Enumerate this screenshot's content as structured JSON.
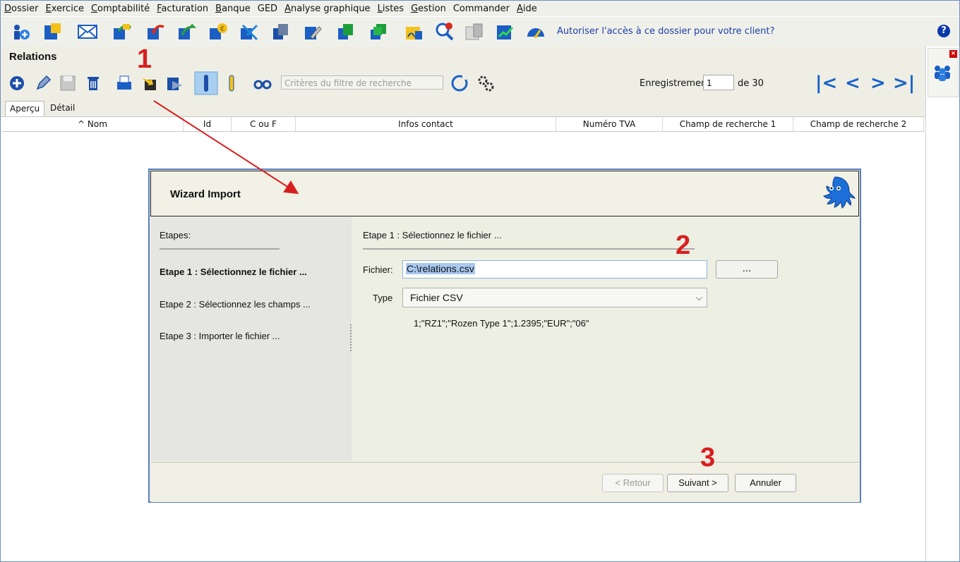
{
  "menu": [
    "Dossier",
    "Exercice",
    "Comptabilité",
    "Facturation",
    "Banque",
    "GED",
    "Analyse graphique",
    "Listes",
    "Gestion",
    "Commander",
    "Aide"
  ],
  "menu_underline": [
    0,
    0,
    0,
    0,
    0,
    null,
    0,
    0,
    0,
    null,
    0
  ],
  "main_toolbar": {
    "icons": [
      "add-dossier-icon",
      "notes-icon",
      "mail-icon",
      "exchange-icon",
      "import-icon",
      "export-icon",
      "currency-icon",
      "transfer-icon",
      "copy-icon",
      "edit-doc-icon",
      "green-doc-icon",
      "green-stack-icon",
      "sign-icon",
      "search-doc-icon",
      "doc-grid-icon",
      "chart-icon",
      "dashboard-icon"
    ],
    "link": "Autoriser l'accès à ce dossier pour votre client?",
    "help": "?"
  },
  "relations": {
    "title": "Relations",
    "search_placeholder": "Critères du filtre de recherche",
    "record_label": "Enregistrement",
    "record_value": "1",
    "record_of": "de 30",
    "nav": {
      "first": "|<",
      "prev": "<",
      "next": ">",
      "last": ">|"
    }
  },
  "tabs": [
    "Aperçu",
    "Détail"
  ],
  "columns": [
    "^ Nom",
    "Id",
    "C ou F",
    "Infos contact",
    "Numéro TVA",
    "Champ de recherche 1",
    "Champ de recherche 2"
  ],
  "wizard": {
    "title": "Wizard Import",
    "side_title": "Etapes:",
    "steps": [
      "Etape 1 : Sélectionnez le fichier ...",
      "Etape 2 : Sélectionnez les champs ...",
      "Etape 3 : Importer le fichier ..."
    ],
    "current_step_title": "Etape 1 : Sélectionnez le fichier ...",
    "file_label": "Fichier:",
    "file_value": "C:\\relations.csv",
    "browse_label": "...",
    "type_label": "Type",
    "type_value": "Fichier CSV",
    "preview_line": "1;\"RZ1\";\"Rozen Type 1\";1.2395;\"EUR\";\"06\"",
    "buttons": {
      "back": "< Retour",
      "next": "Suivant >",
      "cancel": "Annuler"
    }
  },
  "annotations": [
    "1",
    "2",
    "3"
  ],
  "colors": {
    "accent": "#1a62c9",
    "annotation": "#d91e1e",
    "wizard_border": "#5a7fbf"
  }
}
